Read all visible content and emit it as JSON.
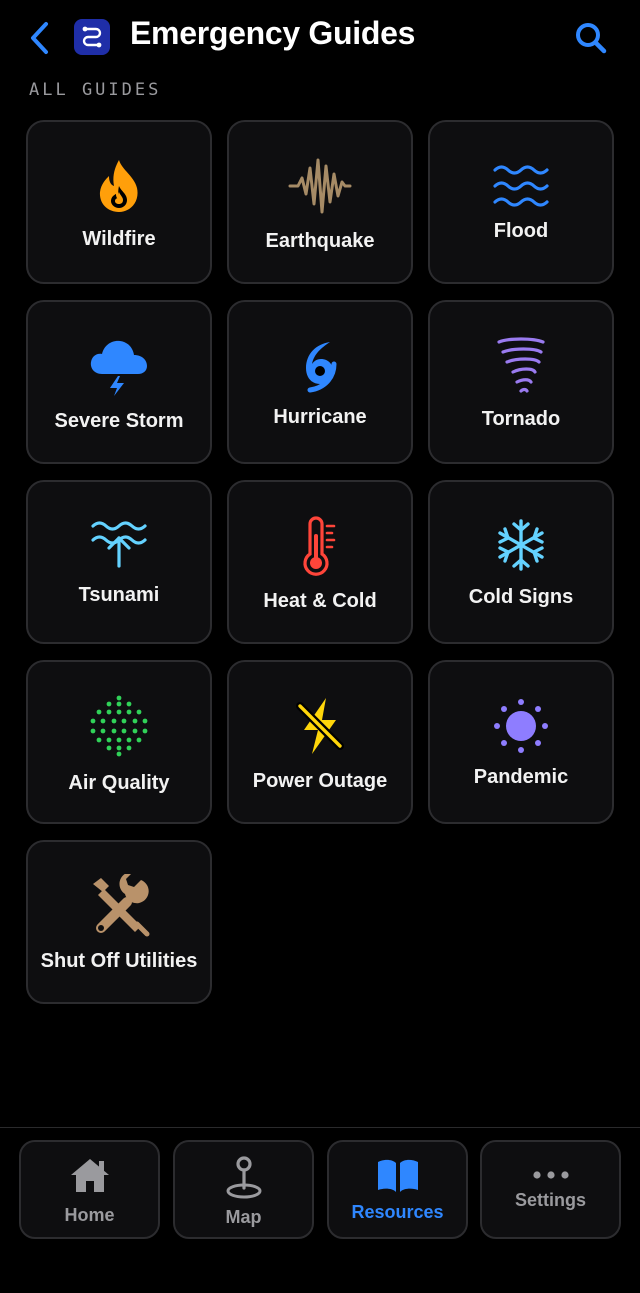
{
  "header": {
    "title": "Emergency Guides"
  },
  "section_label": "ALL GUIDES",
  "guides": [
    {
      "label": "Wildfire",
      "icon": "flame-icon",
      "color": "#ff9f0a"
    },
    {
      "label": "Earthquake",
      "icon": "seismic-wave-icon",
      "color": "#a68b66"
    },
    {
      "label": "Flood",
      "icon": "water-waves-icon",
      "color": "#2f87ff"
    },
    {
      "label": "Severe Storm",
      "icon": "cloud-bolt-icon",
      "color": "#2f87ff"
    },
    {
      "label": "Hurricane",
      "icon": "hurricane-icon",
      "color": "#2f87ff"
    },
    {
      "label": "Tornado",
      "icon": "tornado-icon",
      "color": "#9a7bf0"
    },
    {
      "label": "Tsunami",
      "icon": "tsunami-icon",
      "color": "#64d2ff"
    },
    {
      "label": "Heat & Cold",
      "icon": "thermometer-icon",
      "color": "#ff453a"
    },
    {
      "label": "Cold Signs",
      "icon": "snowflake-icon",
      "color": "#64d2ff"
    },
    {
      "label": "Air Quality",
      "icon": "dots-circle-icon",
      "color": "#30d158"
    },
    {
      "label": "Power Outage",
      "icon": "bolt-slash-icon",
      "color": "#ffd60a"
    },
    {
      "label": "Pandemic",
      "icon": "virus-icon",
      "color": "#8e7dff"
    },
    {
      "label": "Shut Off Utilities",
      "icon": "wrench-screwdriver-icon",
      "color": "#b9926a"
    }
  ],
  "nav": [
    {
      "label": "Home",
      "icon": "house-icon",
      "active": false
    },
    {
      "label": "Map",
      "icon": "map-pin-icon",
      "active": false
    },
    {
      "label": "Resources",
      "icon": "book-icon",
      "active": true
    },
    {
      "label": "Settings",
      "icon": "ellipsis-icon",
      "active": false
    }
  ],
  "colors": {
    "accent": "#2f87ff",
    "background": "#000000",
    "tile": "#0e0e10",
    "tile_border": "#2c2c2f",
    "inactive": "#9a9a9e"
  }
}
